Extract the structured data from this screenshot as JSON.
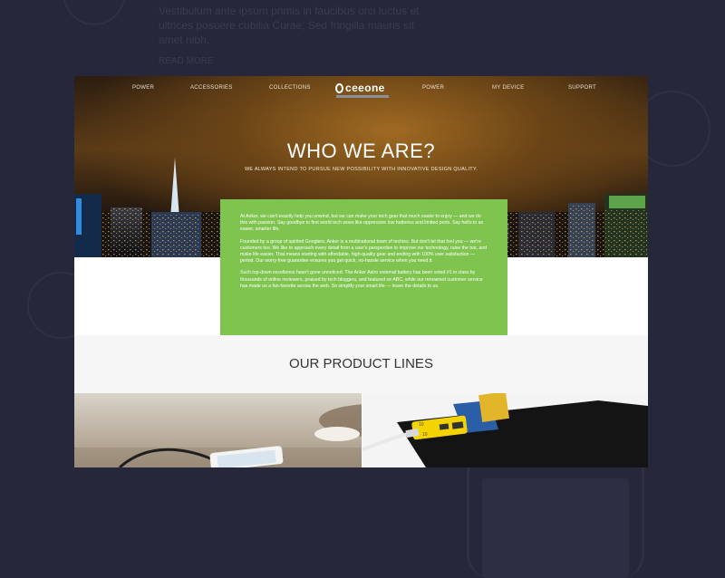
{
  "background": {
    "text_lines": [
      "Vestibulum ante ipsum primis in faucibus orci luctus et",
      "ultrices posuere cubilia Curae; Sed fringilla mauris sit",
      "amet nibh."
    ],
    "link": "READ MORE"
  },
  "nav": {
    "items": [
      "POWER",
      "ACCESSORIES",
      "COLLECTIONS",
      "POWER",
      "MY DEVICE",
      "SUPPORT"
    ],
    "logo_text": "ceeone"
  },
  "hero": {
    "title": "WHO WE ARE?",
    "subtitle": "WE ALWAYS INTEND TO PURSUE NEW POSSIBILITY WITH INNOVATIVE DESIGN QUALITY."
  },
  "about": {
    "paragraphs": [
      "At Anker, we can't exactly help you unwind, but we can make your tech gear that much easier to enjoy — and we do this with passion. Say goodbye to first world tech woes like oppressive low batteries and limited ports. Say hello to an easier, smarter life.",
      "Founded by a group of spirited Googlers, Anker is a multinational team of techies. But don't let that fool you — we're customers too. We like to approach every detail from a user's perspective to improve our technology, raise the bar, and make life easier. That means starting with affordable, high-quality gear and ending with 100% user satisfaction — period. Our worry-free guarantee ensures you get quick, no-hassle service when you need it.",
      "Such top-down excellence hasn't gone unnoticed. The Anker Astro external battery has been voted #1 in class by thousands of online reviewers, praised by tech bloggers, and featured on ABC, while our renowned customer service has made us a fan-favorite across the web. So simplify your smart life — leave the details to us."
    ]
  },
  "product_lines": {
    "title": "OUR PRODUCT LINES",
    "device_labels": [
      "10",
      "10"
    ]
  },
  "colors": {
    "page_bg": "#26273a",
    "accent_green": "#80c450",
    "battery_yellow": "#f4d400"
  }
}
